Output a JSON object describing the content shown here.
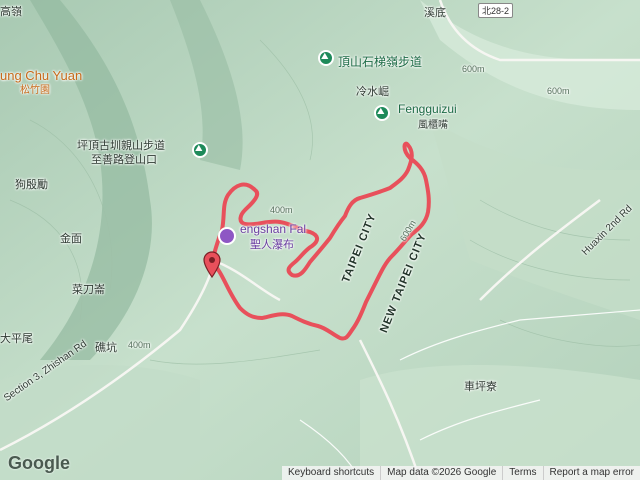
{
  "labels": {
    "top_left": "高嶺",
    "chung_chu_yuan": "ung Chu Yuan",
    "chung_chu_yuan_cn": "松竹園",
    "trail_start_1": "坪頂古圳親山步道",
    "trail_start_2": "至善路登山口",
    "gou_dian_lai": "狗殷勵",
    "jin_mian": "金面",
    "cai_dao_lun": "菜刀崙",
    "da_ping_wei": "大平尾",
    "tie_keng": "礁坑",
    "section3_road": "Section 3, Zhishan Rd",
    "dingshan_trail": "頂山石梯嶺步道",
    "leng_shui_keng": "冷水崛",
    "fengguizui": "Fengguizui",
    "fengguizui_cn": "風櫃嘴",
    "xi_di": "溪底",
    "bei28_2": "北28-2",
    "waterfall_en": "engshan Fal",
    "waterfall_cn": "聖人瀑布",
    "taipei_city": "TAIPEI CITY",
    "new_taipei_city": "NEW TAIPEI CITY",
    "huaxin_rd": "Huaxin 2nd Rd",
    "che_ping_liao": "車坪寮",
    "contour_400m": "400m",
    "contour_600m": "600m",
    "contour_600m_b": "600m",
    "contour_600m_c": "600m",
    "contour_400m_b": "400m"
  },
  "attribution": {
    "logo": "Google",
    "shortcuts": "Keyboard shortcuts",
    "map_data": "Map data ©2026 Google",
    "terms": "Terms",
    "report": "Report a map error"
  },
  "colors": {
    "route": "#e8505b",
    "terrain_light": "#cfe6d2",
    "terrain_dark": "#8fb59c",
    "poi_green": "#1e8a5a",
    "poi_purple": "#8e57c4"
  },
  "icons": {
    "trailhead_marker": "map-pin-icon",
    "hiking_poi": "hiking-icon",
    "waterfall_poi": "waterfall-icon"
  }
}
